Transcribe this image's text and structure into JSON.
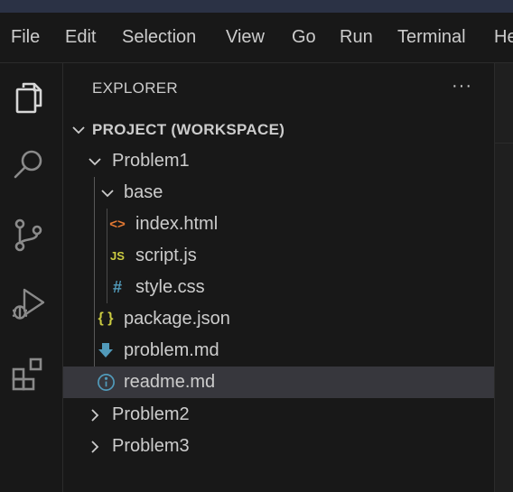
{
  "menu": [
    "File",
    "Edit",
    "Selection",
    "View",
    "Go",
    "Run",
    "Terminal",
    "He"
  ],
  "activity_bar": [
    {
      "name": "explorer",
      "icon": "files-icon"
    },
    {
      "name": "search",
      "icon": "search-icon"
    },
    {
      "name": "source-control",
      "icon": "source-control-icon"
    },
    {
      "name": "run-and-debug",
      "icon": "run-debug-icon"
    },
    {
      "name": "extensions",
      "icon": "extensions-icon"
    }
  ],
  "sidebar": {
    "title": "EXPLORER",
    "more": "···",
    "tree": [
      {
        "label": "PROJECT (WORKSPACE)",
        "kind": "root",
        "expanded": true
      },
      {
        "label": "Problem1",
        "kind": "folder",
        "expanded": true
      },
      {
        "label": "base",
        "kind": "folder",
        "expanded": true
      },
      {
        "label": "index.html",
        "kind": "file",
        "icon": "<>",
        "icon_color": "#e37933"
      },
      {
        "label": "script.js",
        "kind": "file",
        "icon": "JS",
        "icon_color": "#cbcb41"
      },
      {
        "label": "style.css",
        "kind": "file",
        "icon": "#",
        "icon_color": "#519aba"
      },
      {
        "label": "package.json",
        "kind": "file",
        "icon": "{ }",
        "icon_color": "#cbcb41"
      },
      {
        "label": "problem.md",
        "kind": "file",
        "icon": "download-arrow-icon",
        "icon_color": "#519aba"
      },
      {
        "label": "readme.md",
        "kind": "file",
        "icon": "info-icon",
        "icon_color": "#519aba",
        "selected": true
      },
      {
        "label": "Problem2",
        "kind": "folder",
        "expanded": false
      },
      {
        "label": "Problem3",
        "kind": "folder",
        "expanded": false
      }
    ]
  },
  "colors": {
    "background": "#181818",
    "selection": "#37373d",
    "text": "#cccccc",
    "top_strip": "#2b3245"
  }
}
